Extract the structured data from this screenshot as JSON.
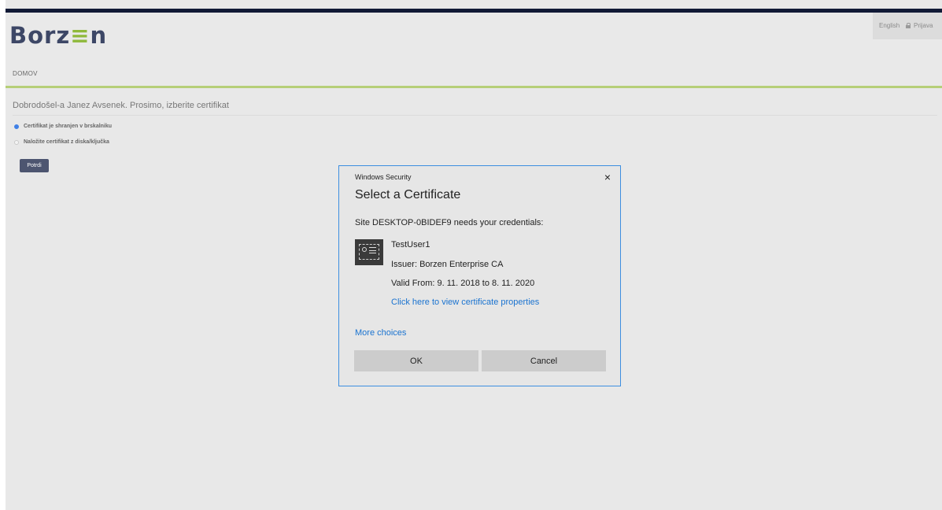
{
  "header": {
    "logo_text": "Borz",
    "logo_e": "≡",
    "logo_end": "n",
    "language": "English",
    "login": "Prijava"
  },
  "nav": {
    "home": "DOMOV"
  },
  "main": {
    "welcome": "Dobrodošel-a Janez Avsenek. Prosimo, izberite certifikat",
    "options": [
      {
        "label": "Certifikat je shranjen v brskalniku",
        "checked": true
      },
      {
        "label": "Naložite certifikat z diska/ključka",
        "checked": false
      }
    ],
    "confirm_button": "Potrdi"
  },
  "dialog": {
    "window_title": "Windows Security",
    "close_symbol": "×",
    "heading": "Select a Certificate",
    "site_text": "Site DESKTOP-0BIDEF9 needs your credentials:",
    "certificate": {
      "name": "TestUser1",
      "issuer": "Issuer: Borzen Enterprise CA",
      "valid": "Valid From: 9. 11. 2018 to 8. 11. 2020",
      "properties_link": "Click here to view certificate properties"
    },
    "more_choices": "More choices",
    "ok_button": "OK",
    "cancel_button": "Cancel"
  },
  "colors": {
    "topbar": "#111a36",
    "accent_green": "#b6cf78",
    "logo": "#3d4766",
    "dialog_border": "#3c8ee0",
    "link": "#1a73d0"
  }
}
